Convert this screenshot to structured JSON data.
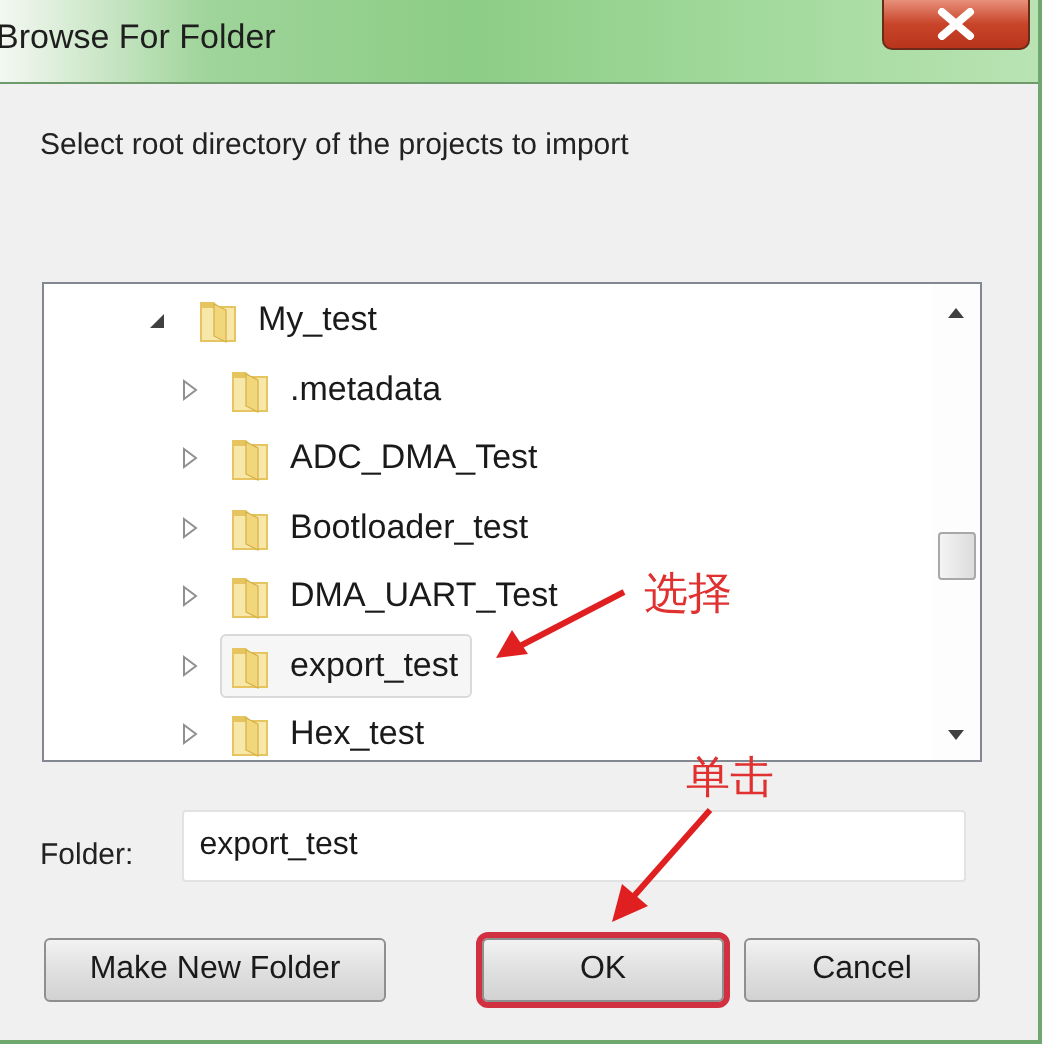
{
  "window": {
    "title": "Browse For Folder"
  },
  "instruction": "Select root directory of the projects to import",
  "tree": [
    {
      "label": "My_test",
      "expanded": true,
      "selected": false,
      "children": [
        {
          "label": ".metadata",
          "expanded": false,
          "selected": false
        },
        {
          "label": "ADC_DMA_Test",
          "expanded": false,
          "selected": false
        },
        {
          "label": "Bootloader_test",
          "expanded": false,
          "selected": false
        },
        {
          "label": "DMA_UART_Test",
          "expanded": false,
          "selected": false
        },
        {
          "label": "export_test",
          "expanded": false,
          "selected": true
        },
        {
          "label": "Hex_test",
          "expanded": false,
          "selected": false
        }
      ]
    }
  ],
  "folder_field": {
    "label": "Folder:",
    "value": "export_test"
  },
  "buttons": [
    {
      "label": "Make New Folder",
      "highlighted": false
    },
    {
      "label": "OK",
      "highlighted": true
    },
    {
      "label": "Cancel",
      "highlighted": false
    }
  ],
  "annotations": [
    {
      "text": "选择"
    },
    {
      "text": "单击"
    }
  ]
}
